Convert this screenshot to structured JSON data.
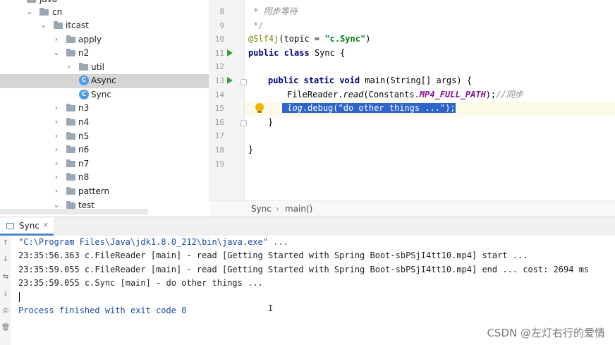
{
  "project_tree": {
    "items": [
      {
        "label": "java",
        "arrow": "",
        "icon": "folder-icon"
      },
      {
        "label": "cn",
        "arrow": "⌄",
        "icon": "folder-icon"
      },
      {
        "label": "itcast",
        "arrow": "⌄",
        "icon": "folder-icon"
      },
      {
        "label": "apply",
        "arrow": "›",
        "icon": "folder-icon"
      },
      {
        "label": "n2",
        "arrow": "⌄",
        "icon": "folder-icon"
      },
      {
        "label": "util",
        "arrow": "›",
        "icon": "folder-icon"
      },
      {
        "label": "Async",
        "arrow": "",
        "icon": "class-icon",
        "selected": true
      },
      {
        "label": "Sync",
        "arrow": "",
        "icon": "class-icon"
      },
      {
        "label": "n3",
        "arrow": "›",
        "icon": "folder-icon"
      },
      {
        "label": "n4",
        "arrow": "›",
        "icon": "folder-icon"
      },
      {
        "label": "n5",
        "arrow": "›",
        "icon": "folder-icon"
      },
      {
        "label": "n6",
        "arrow": "›",
        "icon": "folder-icon"
      },
      {
        "label": "n7",
        "arrow": "›",
        "icon": "folder-icon"
      },
      {
        "label": "n8",
        "arrow": "›",
        "icon": "folder-icon"
      },
      {
        "label": "pattern",
        "arrow": "›",
        "icon": "folder-icon"
      },
      {
        "label": "test",
        "arrow": "⌄",
        "icon": "folder-icon"
      }
    ]
  },
  "editor": {
    "line_numbers": [
      "8",
      "9",
      "10",
      "11",
      "12",
      "13",
      "14",
      "15",
      "16",
      "17",
      "18",
      "19"
    ],
    "code": {
      "l8_comment": " * 同步等待",
      "l9_comment": " */",
      "l10_annotation": "@Slf4j",
      "l10_paren_open": "(topic = ",
      "l10_string": "\"c.Sync\"",
      "l10_paren_close": ")",
      "l11_kw1": "public",
      "l11_kw2": "class",
      "l11_rest": " Sync {",
      "l13_kw1": "public",
      "l13_kw2": "static",
      "l13_kw3": "void",
      "l13_rest": " main(String[] args) {",
      "l14_obj": "FileReader.",
      "l14_method": "read",
      "l14_args_open": "(Constants.",
      "l14_const": "MP4_FULL_PATH",
      "l14_args_close": ");",
      "l14_comment": "//同步",
      "l15_log": "log",
      "l15_rest": ".debug(\"do other things ...\");",
      "l16": "}",
      "l18": "}"
    },
    "breadcrumb": [
      "Sync",
      "›",
      "main()"
    ]
  },
  "run_panel": {
    "tab_label": "Sync",
    "tab_close": "×",
    "tool_icons": [
      "↑",
      "↓",
      "⇆",
      "⤓",
      "⎙",
      "🗑"
    ],
    "output": [
      "\"C:\\Program Files\\Java\\jdk1.8.0_212\\bin\\java.exe\" ...",
      "23:35:56.363 c.FileReader [main] - read [Getting Started with Spring Boot-sbPSjI4tt10.mp4] start ...",
      "23:35:59.055 c.FileReader [main] - read [Getting Started with Spring Boot-sbPSjI4tt10.mp4] end ... cost: 2694 ms",
      "23:35:59.055 c.Sync [main] - do other things ...",
      "Process finished with exit code 0"
    ],
    "ibeam_glyph": "I"
  },
  "watermark": "CSDN @左灯右行的爱情"
}
